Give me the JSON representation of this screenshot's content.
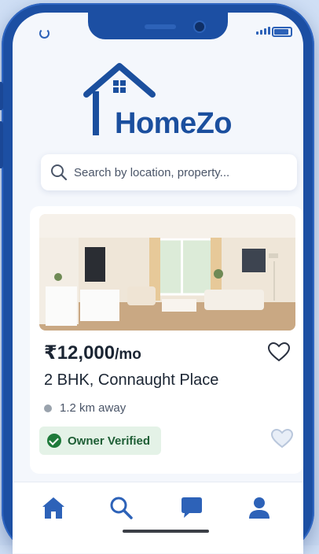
{
  "app": {
    "brand": "HomeZo"
  },
  "search": {
    "placeholder": "Search by location, property..."
  },
  "listing": {
    "price": "₹12,000",
    "price_suffix": "/mo",
    "title": "2 BHK, Connaught Place",
    "distance": "1.2 km away",
    "badge": "Owner Verified"
  },
  "nav": {
    "tabs": [
      {
        "icon": "home-icon",
        "active": true
      },
      {
        "icon": "search-icon",
        "active": false
      },
      {
        "icon": "chat-icon",
        "active": false
      },
      {
        "icon": "profile-icon",
        "active": false
      }
    ]
  },
  "colors": {
    "brand": "#1b4f9e",
    "phone_frame": "#1c4fa3",
    "nav_active": "#2d62b8",
    "verified_bg": "#e4f2e7",
    "verified_fg": "#1e7a3a"
  }
}
